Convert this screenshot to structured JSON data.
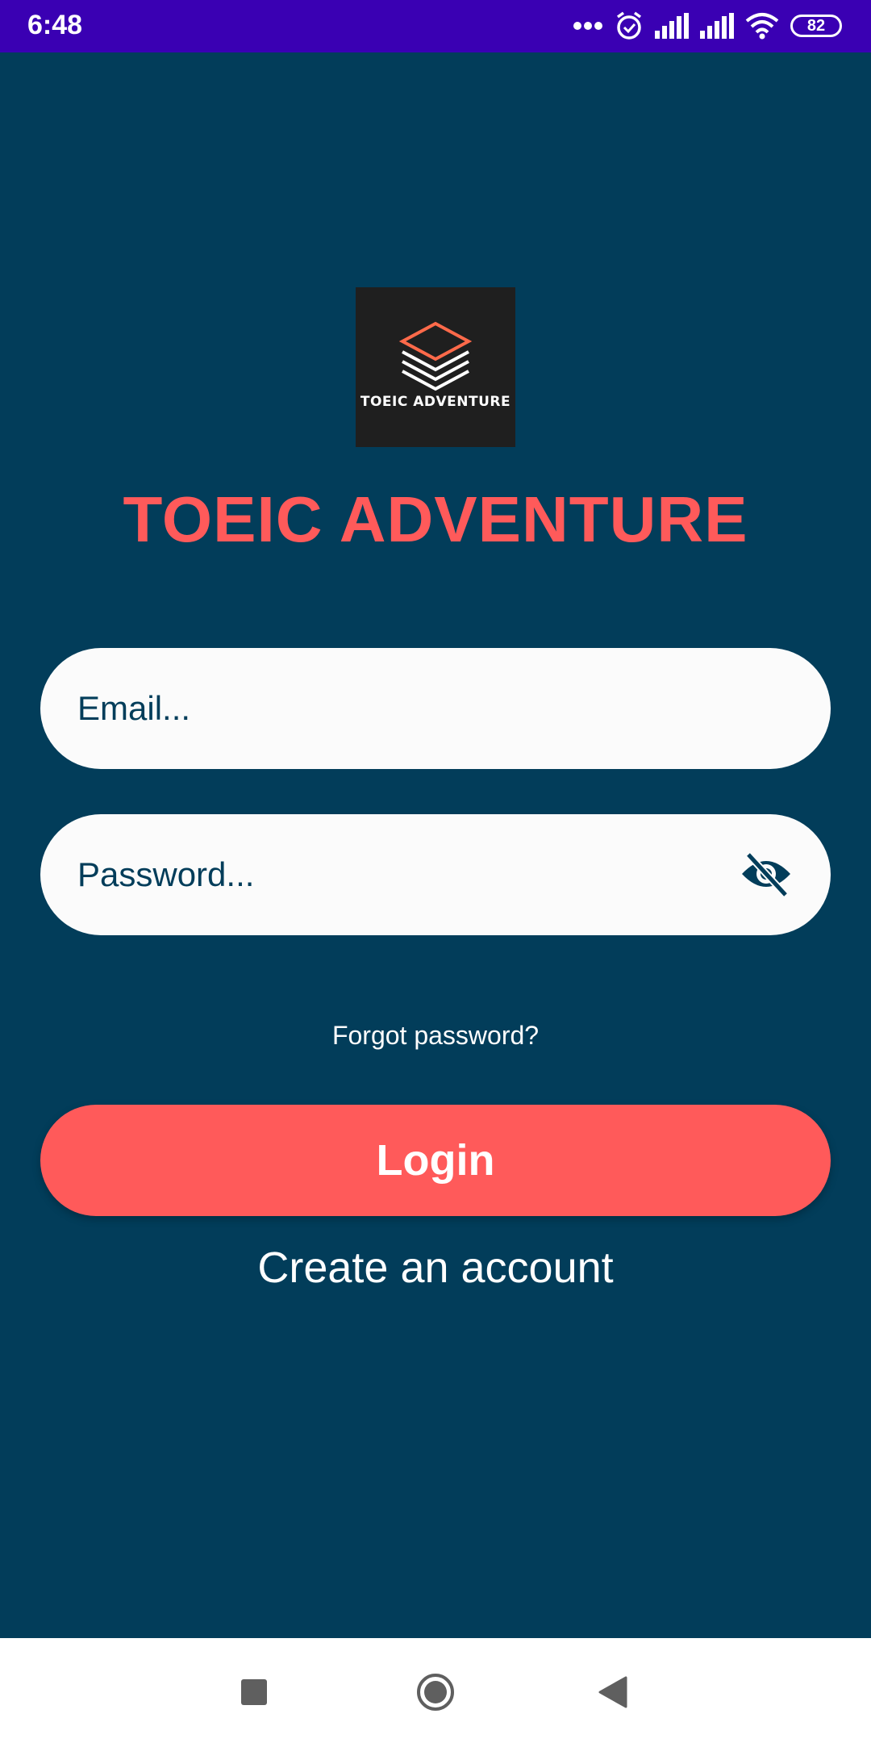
{
  "status_bar": {
    "time": "6:48",
    "battery_level": "82",
    "icons": [
      "more-dots-icon",
      "alarm-icon",
      "signal-icon",
      "signal-icon",
      "wifi-icon",
      "battery-icon"
    ]
  },
  "logo": {
    "text": "TOEIC ADVENTURE",
    "icon": "stacked-layers-icon"
  },
  "app_title": "TOEIC ADVENTURE",
  "form": {
    "email_placeholder": "Email...",
    "email_value": "",
    "password_placeholder": "Password...",
    "password_value": "",
    "password_toggle_icon": "eye-off-icon",
    "forgot_password": "Forgot password?",
    "login_label": "Login",
    "create_account": "Create an account"
  },
  "colors": {
    "background": "#023d5a",
    "status_bar": "#3a00b3",
    "accent": "#ff5a5a",
    "field_background": "#fbfbfb"
  },
  "nav_bar": {
    "icons": [
      "recents-square-icon",
      "home-circle-icon",
      "back-triangle-icon"
    ]
  }
}
